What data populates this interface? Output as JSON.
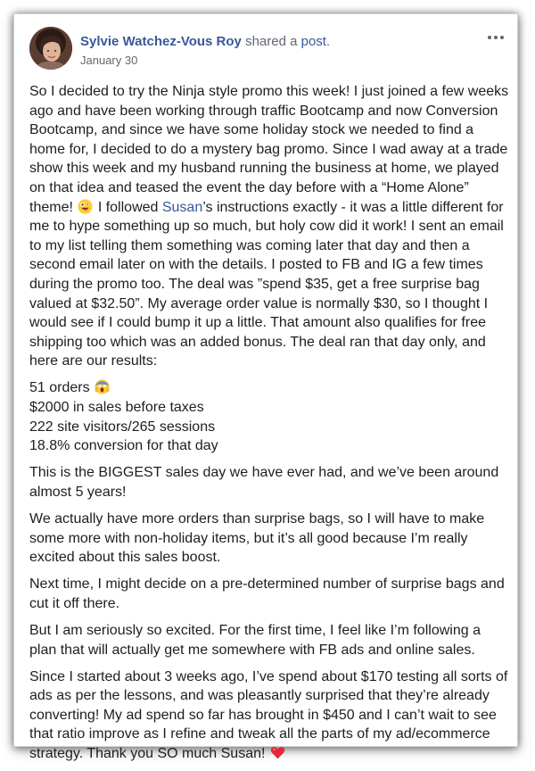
{
  "post": {
    "author": "Sylvie Watchez-Vous Roy",
    "shared_prefix": "shared a",
    "shared_link": "post",
    "shared_suffix": ".",
    "date": "January 30",
    "p1_a": "So I decided to try the Ninja style promo this week! I just joined a few weeks ago and have been working through traffic Bootcamp and now Conversion Bootcamp, and since we have some holiday stock we needed to find a home for, I decided to do a mystery bag promo. Since I wad away at a trade show this week and my husband running the business at home, we played on that idea and teased the event the day before with a “Home Alone” theme!",
    "p1_b": " I followed ",
    "mention": "Susan",
    "p1_c": "’s instructions exactly - it was a little different for me to hype something up so much, but holy cow did it work! I sent an email to my list telling them something was coming later that day and then a second email later on with the details. I posted to FB and IG a few times during the promo too. The deal was ”spend $35, get a free surprise bag valued at $32.50”. My average order value is normally $30, so I thought I would see if I could bump it up a little. That amount also qualifies for free shipping too which was an added bonus. The deal ran that day only, and here are our results:",
    "results": {
      "orders": "51 orders",
      "sales": "$2000 in sales before taxes",
      "visitors": "222 site visitors/265 sessions",
      "conversion": "18.8% conversion for that day"
    },
    "p2": "This is the BIGGEST sales day we have ever had, and we’ve been around almost 5 years!",
    "p3": "We actually have more orders than surprise bags, so I will have to make some more with non-holiday items, but it’s all good because I’m really excited about this sales boost.",
    "p4": "Next time, I might decide on a pre-determined number of surprise bags and cut it off there.",
    "p5": "But I am seriously so excited. For the first time, I feel like I’m following a plan that will actually get me somewhere with FB ads and online sales.",
    "p6": "Since I started about 3 weeks ago, I’ve spend about $170 testing all sorts of ads as per the lessons, and was pleasantly surprised that they’re already converting! My ad spend so far has brought in $450 and I can’t wait to see that ratio improve as I refine and tweak all the parts of my ad/ecommerce strategy. Thank you SO much Susan!"
  },
  "icons": {
    "avatar": "avatar-photo",
    "more": "more-options-icon",
    "emoji_1": "crazy-face-emoji",
    "emoji_2": "screaming-face-emoji",
    "emoji_3": "red-heart-emoji"
  },
  "colors": {
    "link": "#385898",
    "text": "#1c1e21",
    "secondary": "#606770",
    "heart": "#e02a3a"
  }
}
